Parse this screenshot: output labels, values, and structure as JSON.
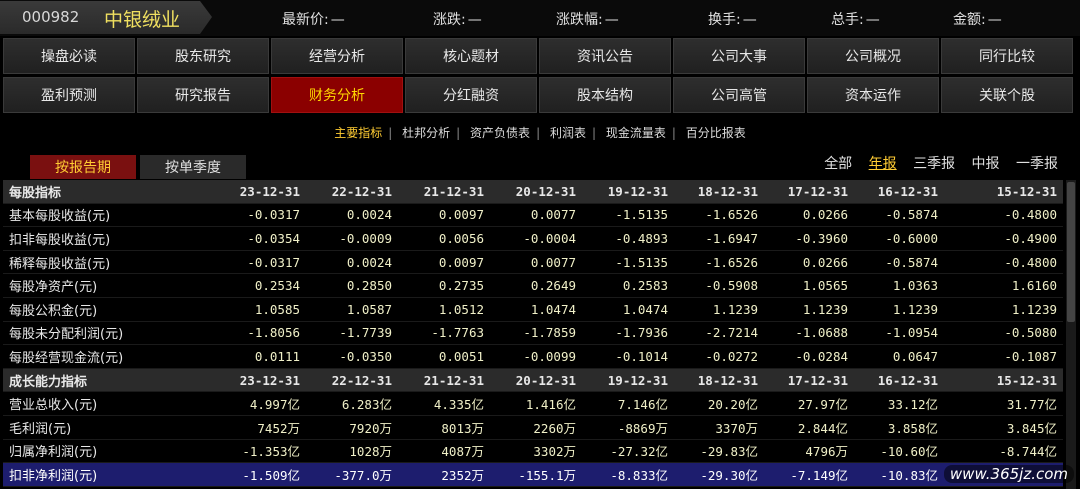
{
  "header": {
    "stock_code": "000982",
    "stock_name": "中银绒业",
    "quote_fields": [
      {
        "label": "最新价:",
        "value": "—"
      },
      {
        "label": "涨跌:",
        "value": "—"
      },
      {
        "label": "涨跌幅:",
        "value": "—"
      },
      {
        "label": "换手:",
        "value": "—"
      },
      {
        "label": "总手:",
        "value": "—"
      },
      {
        "label": "金额:",
        "value": "—"
      }
    ]
  },
  "nav": {
    "row1": [
      "操盘必读",
      "股东研究",
      "经营分析",
      "核心题材",
      "资讯公告",
      "公司大事",
      "公司概况",
      "同行比较"
    ],
    "row2": [
      "盈利预测",
      "研究报告",
      "财务分析",
      "分红融资",
      "股本结构",
      "公司高管",
      "资本运作",
      "关联个股"
    ]
  },
  "subtabs": [
    "主要指标",
    "杜邦分析",
    "资产负债表",
    "利润表",
    "现金流量表",
    "百分比报表"
  ],
  "period_tabs": [
    "按报告期",
    "按单季度"
  ],
  "range_options": [
    "全部",
    "年报",
    "三季报",
    "中报",
    "一季报"
  ],
  "table": {
    "sections": [
      {
        "title": "每股指标",
        "dates": [
          "23-12-31",
          "22-12-31",
          "21-12-31",
          "20-12-31",
          "19-12-31",
          "18-12-31",
          "17-12-31",
          "16-12-31",
          "15-12-31"
        ],
        "rows": [
          {
            "label": "基本每股收益(元)",
            "values": [
              "-0.0317",
              "0.0024",
              "0.0097",
              "0.0077",
              "-1.5135",
              "-1.6526",
              "0.0266",
              "-0.5874",
              "-0.4800"
            ]
          },
          {
            "label": "扣非每股收益(元)",
            "values": [
              "-0.0354",
              "-0.0009",
              "0.0056",
              "-0.0004",
              "-0.4893",
              "-1.6947",
              "-0.3960",
              "-0.6000",
              "-0.4900"
            ]
          },
          {
            "label": "稀释每股收益(元)",
            "values": [
              "-0.0317",
              "0.0024",
              "0.0097",
              "0.0077",
              "-1.5135",
              "-1.6526",
              "0.0266",
              "-0.5874",
              "-0.4800"
            ]
          },
          {
            "label": "每股净资产(元)",
            "values": [
              "0.2534",
              "0.2850",
              "0.2735",
              "0.2649",
              "0.2583",
              "-0.5908",
              "1.0565",
              "1.0363",
              "1.6160"
            ]
          },
          {
            "label": "每股公积金(元)",
            "values": [
              "1.0585",
              "1.0587",
              "1.0512",
              "1.0474",
              "1.0474",
              "1.1239",
              "1.1239",
              "1.1239",
              "1.1239"
            ]
          },
          {
            "label": "每股未分配利润(元)",
            "values": [
              "-1.8056",
              "-1.7739",
              "-1.7763",
              "-1.7859",
              "-1.7936",
              "-2.7214",
              "-1.0688",
              "-1.0954",
              "-0.5080"
            ]
          },
          {
            "label": "每股经营现金流(元)",
            "values": [
              "0.0111",
              "-0.0350",
              "0.0051",
              "-0.0099",
              "-0.1014",
              "-0.0272",
              "-0.0284",
              "0.0647",
              "-0.1087"
            ]
          }
        ]
      },
      {
        "title": "成长能力指标",
        "dates": [
          "23-12-31",
          "22-12-31",
          "21-12-31",
          "20-12-31",
          "19-12-31",
          "18-12-31",
          "17-12-31",
          "16-12-31",
          "15-12-31"
        ],
        "rows": [
          {
            "label": "营业总收入(元)",
            "values": [
              "4.997亿",
              "6.283亿",
              "4.335亿",
              "1.416亿",
              "7.146亿",
              "20.20亿",
              "27.97亿",
              "33.12亿",
              "31.77亿"
            ]
          },
          {
            "label": "毛利润(元)",
            "values": [
              "7452万",
              "7920万",
              "8013万",
              "2260万",
              "-8869万",
              "3370万",
              "2.844亿",
              "3.858亿",
              "3.845亿"
            ]
          },
          {
            "label": "归属净利润(元)",
            "values": [
              "-1.353亿",
              "1028万",
              "4087万",
              "3302万",
              "-27.32亿",
              "-29.83亿",
              "4796万",
              "-10.60亿",
              "-8.744亿"
            ]
          },
          {
            "label": "扣非净利润(元)",
            "values": [
              "-1.509亿",
              "-377.0万",
              "2352万",
              "-155.1万",
              "-8.833亿",
              "-29.30亿",
              "-7.149亿",
              "-10.83亿",
              ""
            ]
          }
        ]
      }
    ]
  },
  "watermark": "www.365jz.com"
}
